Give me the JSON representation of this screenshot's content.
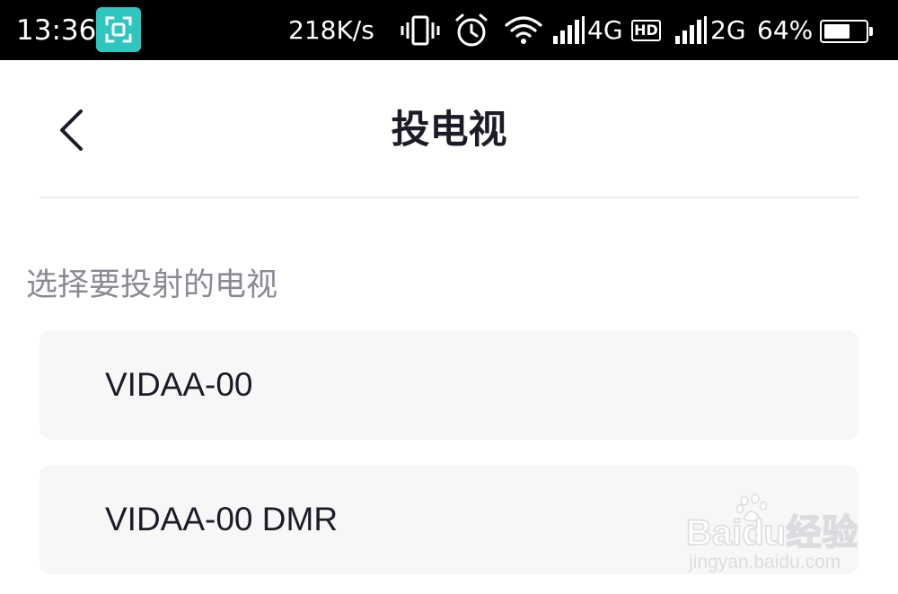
{
  "status_bar": {
    "time": "13:36",
    "network_speed": "218K/s",
    "signal_1_type": "4G",
    "hd_badge": "HD",
    "signal_2_type": "2G",
    "battery_text": "64%",
    "battery_level": 0.64,
    "icons": [
      "screenshot-icon",
      "vibrate-icon",
      "alarm-icon",
      "wifi-icon",
      "signal-icon",
      "battery-icon"
    ]
  },
  "header": {
    "title": "投电视",
    "back_icon": "chevron-left-icon"
  },
  "main": {
    "section_label": "选择要投射的电视",
    "devices": [
      {
        "name": "VIDAA-00"
      },
      {
        "name": "VIDAA-00 DMR"
      }
    ]
  },
  "watermark": {
    "logo_text": "Baidu经验",
    "url_text": "jingyan.baidu.com"
  },
  "colors": {
    "status_bar_bg": "#000000",
    "screenshot_badge": "#2fc6c0",
    "title_text": "#1c1c28",
    "label_text": "#8a8a93",
    "item_bg": "#f7f7f8",
    "divider": "#ececef"
  }
}
